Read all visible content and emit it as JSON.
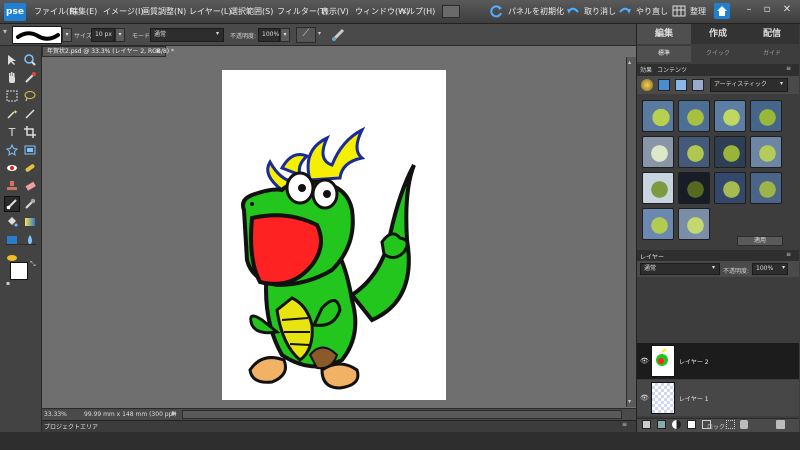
{
  "app": {
    "logo_text": "pse"
  },
  "menu": {
    "items": [
      "ファイル(F)",
      "編集(E)",
      "イメージ(I)",
      "画質調整(N)",
      "レイヤー(L)",
      "選択範囲(S)",
      "フィルター(T)",
      "表示(V)",
      "ウィンドウ(W)",
      "ヘルプ(H)"
    ],
    "reset_panels": "パネルを初期化",
    "undo": "取り消し",
    "redo": "やり直し",
    "organizer": "整理"
  },
  "options": {
    "size_label": "サイズ:",
    "size_value": "10 px",
    "mode_label": "モード:",
    "mode_value": "通常",
    "opacity_label": "不透明度:",
    "opacity_value": "100%"
  },
  "document": {
    "tab_label": "年賀状2.psd @ 33.3% (レイヤー 2, RGB/8) *",
    "zoom": "33.33%",
    "doc_info": "99.99 mm x 148 mm (300 ppi)",
    "project_bin": "プロジェクトエリア"
  },
  "right_panel": {
    "main_tabs": [
      "編集",
      "作成",
      "配信"
    ],
    "sub_tabs": [
      "標準",
      "クイック",
      "ガイド"
    ],
    "effects_tabs": [
      "効果",
      "コンテンツ"
    ],
    "artistic_select": "アーティスティック",
    "apply_button": "適用",
    "layers_title": "レイヤー",
    "blend_mode": "通常",
    "opacity_label": "不透明度:",
    "opacity_value": "100%",
    "lock_label": "ロック:",
    "layers": [
      {
        "name": "レイヤー 2"
      },
      {
        "name": "レイヤー 1"
      }
    ]
  },
  "colors": {
    "accent": "#1f7fd1",
    "dragon_green": "#22c61c",
    "mouth_red": "#ff2222",
    "horn_yellow": "#f4f000"
  }
}
